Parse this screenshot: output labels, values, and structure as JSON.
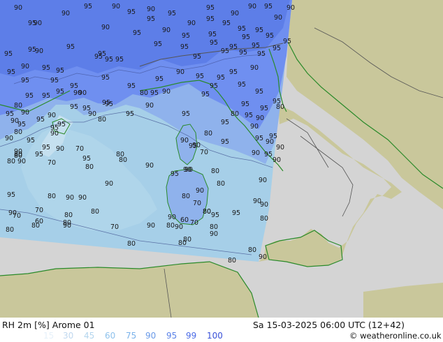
{
  "map": {
    "contour_labels": [
      "90",
      "90",
      "95",
      "90",
      "95",
      "90",
      "95",
      "95",
      "90",
      "90",
      "95",
      "90",
      "90",
      "90",
      "95",
      "90",
      "95",
      "95",
      "95",
      "95",
      "90",
      "95",
      "95",
      "90",
      "95",
      "95",
      "95",
      "95",
      "95",
      "95",
      "95",
      "95",
      "95",
      "90",
      "95",
      "95",
      "95",
      "95",
      "95",
      "95",
      "95",
      "95",
      "95",
      "95",
      "95",
      "95",
      "95",
      "90",
      "95",
      "95",
      "95",
      "95",
      "95",
      "95",
      "90",
      "95",
      "95",
      "95",
      "95",
      "95",
      "95",
      "90",
      "90",
      "80",
      "90",
      "90",
      "95",
      "95",
      "90",
      "95",
      "95",
      "95",
      "95",
      "80",
      "95",
      "95",
      "95",
      "95",
      "95",
      "95",
      "95",
      "90",
      "90",
      "95",
      "90",
      "80",
      "80",
      "95",
      "95",
      "80",
      "90",
      "95",
      "95",
      "95",
      "95",
      "95",
      "90",
      "95",
      "95",
      "95",
      "90",
      "80",
      "90",
      "95",
      "90",
      "95",
      "95",
      "95",
      "90",
      "80",
      "95",
      "90",
      "90",
      "95",
      "95",
      "90",
      "80",
      "80",
      "95",
      "90",
      "70",
      "95",
      "90",
      "90",
      "90",
      "80",
      "90",
      "95",
      "80",
      "80",
      "90",
      "90",
      "90",
      "95",
      "80",
      "90",
      "90",
      "70",
      "80",
      "95",
      "95",
      "80",
      "80",
      "90",
      "70",
      "60",
      "90",
      "70",
      "90",
      "80",
      "80",
      "90",
      "70",
      "60",
      "70",
      "80",
      "80",
      "80",
      "80",
      "80",
      "70",
      "90",
      "90",
      "80",
      "90",
      "80",
      "80",
      "90",
      "70",
      "90",
      "90",
      "80",
      "80",
      "80",
      "80",
      "90",
      "90",
      "80",
      "80",
      "90",
      "80",
      "90"
    ],
    "colors": {
      "land_outside": "#c9c79b",
      "sea_outside": "#d4d4d4",
      "rh_80": "#a6cfe8",
      "rh_90": "#8fb2ec",
      "rh_95": "#6f8ff0",
      "rh_99": "#5d7ee8",
      "coastline": "#2a8a2a",
      "border": "#555555"
    }
  },
  "footer": {
    "title": "RH 2m [%] Arome 01",
    "datetime": "Sa 15-03-2025 06:00 UTC (12+42)",
    "copyright": "© weatheronline.co.uk",
    "legend": [
      {
        "value": "15",
        "color": "#e6f1fa"
      },
      {
        "value": "30",
        "color": "#c0d8ef"
      },
      {
        "value": "45",
        "color": "#b3d5ee"
      },
      {
        "value": "60",
        "color": "#8fc2ec"
      },
      {
        "value": "75",
        "color": "#7ab2ea"
      },
      {
        "value": "90",
        "color": "#6a9ae8"
      },
      {
        "value": "95",
        "color": "#5a82e8"
      },
      {
        "value": "99",
        "color": "#4a6ae6"
      },
      {
        "value": "100",
        "color": "#3850d8"
      }
    ]
  }
}
